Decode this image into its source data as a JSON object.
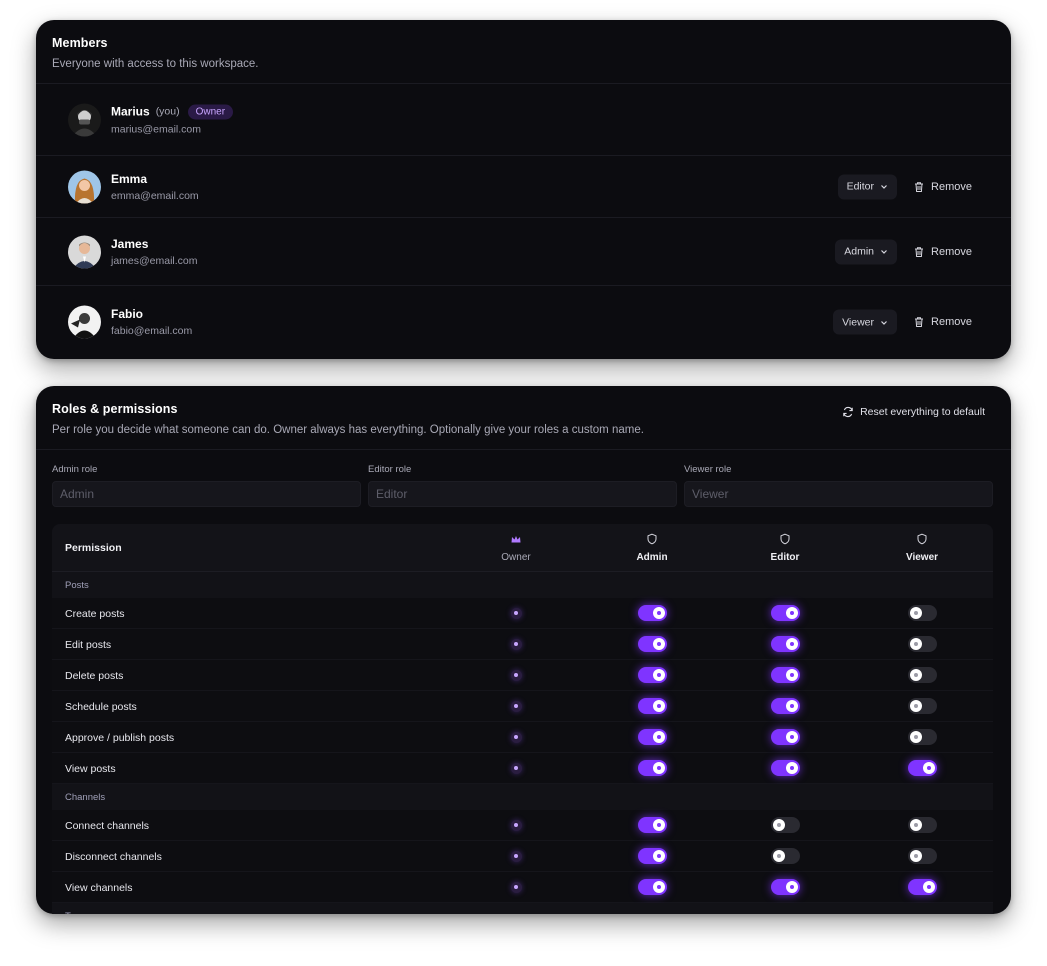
{
  "members": {
    "title": "Members",
    "subtitle": "Everyone with access to this workspace.",
    "remove_label": "Remove",
    "list": [
      {
        "name": "Marius",
        "you": "(you)",
        "badge": "Owner",
        "email": "marius@email.com",
        "role": null
      },
      {
        "name": "Emma",
        "email": "emma@email.com",
        "role": "Editor"
      },
      {
        "name": "James",
        "email": "james@email.com",
        "role": "Admin"
      },
      {
        "name": "Fabio",
        "email": "fabio@email.com",
        "role": "Viewer"
      }
    ]
  },
  "roles": {
    "title": "Roles & permissions",
    "subtitle": "Per role you decide what someone can do. Owner always has everything. Optionally give your roles a custom name.",
    "reset_label": "Reset everything to default",
    "fields": [
      {
        "label": "Admin role",
        "placeholder": "Admin",
        "value": ""
      },
      {
        "label": "Editor role",
        "placeholder": "Editor",
        "value": ""
      },
      {
        "label": "Viewer role",
        "placeholder": "Viewer",
        "value": ""
      }
    ],
    "table": {
      "permission_header": "Permission",
      "columns": [
        "Owner",
        "Admin",
        "Editor",
        "Viewer"
      ],
      "sections": [
        {
          "name": "Posts",
          "rows": [
            {
              "label": "Create posts",
              "admin": true,
              "editor": true,
              "viewer": false
            },
            {
              "label": "Edit posts",
              "admin": true,
              "editor": true,
              "viewer": false
            },
            {
              "label": "Delete posts",
              "admin": true,
              "editor": true,
              "viewer": false
            },
            {
              "label": "Schedule posts",
              "admin": true,
              "editor": true,
              "viewer": false
            },
            {
              "label": "Approve / publish posts",
              "admin": true,
              "editor": true,
              "viewer": false
            },
            {
              "label": "View posts",
              "admin": true,
              "editor": true,
              "viewer": true
            }
          ]
        },
        {
          "name": "Channels",
          "rows": [
            {
              "label": "Connect channels",
              "admin": true,
              "editor": false,
              "viewer": false
            },
            {
              "label": "Disconnect channels",
              "admin": true,
              "editor": false,
              "viewer": false
            },
            {
              "label": "View channels",
              "admin": true,
              "editor": true,
              "viewer": true
            }
          ]
        },
        {
          "name": "Team",
          "rows": []
        }
      ]
    }
  },
  "colors": {
    "accent": "#7f34ff",
    "card_bg": "#0c0c10",
    "owner_badge_bg": "#2a1a46"
  }
}
